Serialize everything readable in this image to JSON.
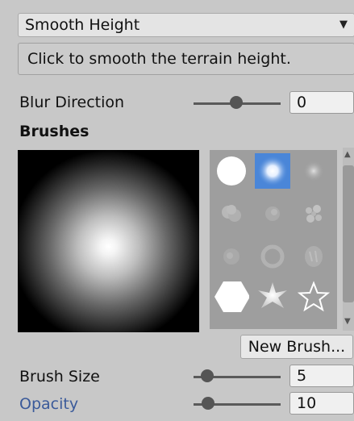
{
  "tool_dropdown": {
    "value": "Smooth Height"
  },
  "description": "Click to smooth the terrain height.",
  "blur_direction": {
    "label": "Blur Direction",
    "value": "0",
    "slider_fraction": 0.5
  },
  "brushes": {
    "heading": "Brushes",
    "selected_index": 1,
    "items": [
      {
        "icon": "hard-round-brush-icon"
      },
      {
        "icon": "soft-round-brush-icon"
      },
      {
        "icon": "faint-soft-brush-icon"
      },
      {
        "icon": "cloud-brush-icon"
      },
      {
        "icon": "leaf-brush-icon"
      },
      {
        "icon": "splatter-brush-icon"
      },
      {
        "icon": "noise-brush-icon"
      },
      {
        "icon": "ring-brush-icon"
      },
      {
        "icon": "texture-brush-icon"
      },
      {
        "icon": "hexagon-brush-icon"
      },
      {
        "icon": "starburst-brush-icon"
      },
      {
        "icon": "star-outline-brush-icon"
      }
    ],
    "new_brush_label": "New Brush..."
  },
  "brush_size": {
    "label": "Brush Size",
    "value": "5",
    "slider_fraction": 0.2
  },
  "opacity": {
    "label": "Opacity",
    "value": "10",
    "slider_fraction": 0.2,
    "label_color": "#3a5a9a"
  },
  "colors": {
    "selection": "#4a86d8"
  }
}
